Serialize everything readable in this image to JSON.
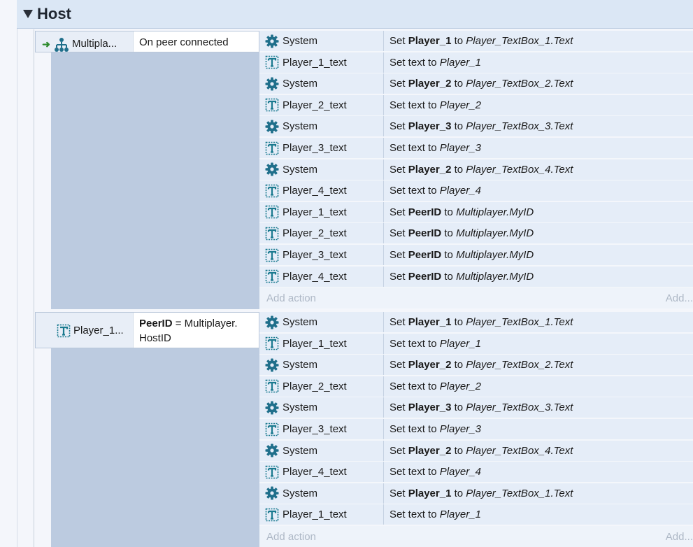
{
  "group": {
    "title": "Host"
  },
  "events": [
    {
      "condition_object": "Multipla...",
      "condition_object_icon": "multiplayer-icon",
      "has_trigger_arrow": true,
      "condition_text_parts": [
        "On peer connected"
      ],
      "actions": [
        {
          "object": "System",
          "icon": "gear-icon",
          "set": "Set ",
          "bold": "Player_1",
          "mid": " to ",
          "italic": "Player_TextBox_1.Text"
        },
        {
          "object": "Player_1_text",
          "icon": "text-object-icon",
          "set": "Set text to ",
          "bold": "",
          "mid": "",
          "italic": "Player_1"
        },
        {
          "object": "System",
          "icon": "gear-icon",
          "set": "Set ",
          "bold": "Player_2",
          "mid": " to ",
          "italic": "Player_TextBox_2.Text"
        },
        {
          "object": "Player_2_text",
          "icon": "text-object-icon",
          "set": "Set text to ",
          "bold": "",
          "mid": "",
          "italic": "Player_2"
        },
        {
          "object": "System",
          "icon": "gear-icon",
          "set": "Set ",
          "bold": "Player_3",
          "mid": " to ",
          "italic": "Player_TextBox_3.Text"
        },
        {
          "object": "Player_3_text",
          "icon": "text-object-icon",
          "set": "Set text to ",
          "bold": "",
          "mid": "",
          "italic": "Player_3"
        },
        {
          "object": "System",
          "icon": "gear-icon",
          "set": "Set ",
          "bold": "Player_2",
          "mid": " to ",
          "italic": "Player_TextBox_4.Text"
        },
        {
          "object": "Player_4_text",
          "icon": "text-object-icon",
          "set": "Set text to ",
          "bold": "",
          "mid": "",
          "italic": "Player_4"
        },
        {
          "object": "Player_1_text",
          "icon": "text-object-icon",
          "set": "Set ",
          "bold": "PeerID",
          "mid": " to ",
          "italic": "Multiplayer.MyID"
        },
        {
          "object": "Player_2_text",
          "icon": "text-object-icon",
          "set": "Set ",
          "bold": "PeerID",
          "mid": " to ",
          "italic": "Multiplayer.MyID"
        },
        {
          "object": "Player_3_text",
          "icon": "text-object-icon",
          "set": "Set ",
          "bold": "PeerID",
          "mid": " to ",
          "italic": "Multiplayer.MyID"
        },
        {
          "object": "Player_4_text",
          "icon": "text-object-icon",
          "set": "Set ",
          "bold": "PeerID",
          "mid": " to ",
          "italic": "Multiplayer.MyID"
        }
      ],
      "add_action": "Add action",
      "add_short": "Add..."
    },
    {
      "condition_object": "Player_1...",
      "condition_object_icon": "text-object-icon",
      "has_trigger_arrow": false,
      "condition_bold": "PeerID",
      "condition_line1": " = Multiplayer.",
      "condition_line2": "HostID",
      "actions": [
        {
          "object": "System",
          "icon": "gear-icon",
          "set": "Set ",
          "bold": "Player_1",
          "mid": " to ",
          "italic": "Player_TextBox_1.Text"
        },
        {
          "object": "Player_1_text",
          "icon": "text-object-icon",
          "set": "Set text to ",
          "bold": "",
          "mid": "",
          "italic": "Player_1"
        },
        {
          "object": "System",
          "icon": "gear-icon",
          "set": "Set ",
          "bold": "Player_2",
          "mid": " to ",
          "italic": "Player_TextBox_2.Text"
        },
        {
          "object": "Player_2_text",
          "icon": "text-object-icon",
          "set": "Set text to ",
          "bold": "",
          "mid": "",
          "italic": "Player_2"
        },
        {
          "object": "System",
          "icon": "gear-icon",
          "set": "Set ",
          "bold": "Player_3",
          "mid": " to ",
          "italic": "Player_TextBox_3.Text"
        },
        {
          "object": "Player_3_text",
          "icon": "text-object-icon",
          "set": "Set text to ",
          "bold": "",
          "mid": "",
          "italic": "Player_3"
        },
        {
          "object": "System",
          "icon": "gear-icon",
          "set": "Set ",
          "bold": "Player_2",
          "mid": " to ",
          "italic": "Player_TextBox_4.Text"
        },
        {
          "object": "Player_4_text",
          "icon": "text-object-icon",
          "set": "Set text to ",
          "bold": "",
          "mid": "",
          "italic": "Player_4"
        },
        {
          "object": "System",
          "icon": "gear-icon",
          "set": "Set ",
          "bold": "Player_1",
          "mid": " to ",
          "italic": "Player_TextBox_1.Text"
        },
        {
          "object": "Player_1_text",
          "icon": "text-object-icon",
          "set": "Set text to ",
          "bold": "",
          "mid": "",
          "italic": "Player_1"
        }
      ],
      "add_action": "Add action",
      "add_short": "Add..."
    }
  ],
  "colors": {
    "group_header_bg": "#dbe7f5",
    "event_body_bg": "#bccbe0",
    "action_row_bg": "#e5edf8",
    "gear_color": "#1f6f8b",
    "text_icon_color": "#1a7a8f",
    "trigger_arrow": "#2e8b2e"
  }
}
